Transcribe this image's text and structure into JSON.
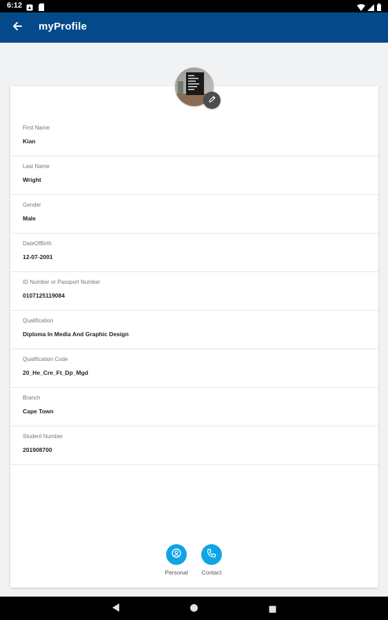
{
  "status_bar": {
    "time": "6:12",
    "left_icons": [
      "notification-icon",
      "sim-card-icon"
    ],
    "right_icons": [
      "wifi-icon",
      "signal-icon",
      "battery-icon"
    ]
  },
  "app_bar": {
    "title": "myProfile",
    "back_icon": "arrow-left-icon",
    "color": "#044a8a"
  },
  "profile": {
    "edit_icon": "pencil-icon",
    "fields": [
      {
        "label": "First Name",
        "value": "Kian"
      },
      {
        "label": "Last Name",
        "value": "Wright"
      },
      {
        "label": "Gender",
        "value": "Male"
      },
      {
        "label": "DateOfBirth",
        "value": "12-07-2001"
      },
      {
        "label": "ID Number or Passport Number",
        "value": "0107125119084"
      },
      {
        "label": "Qualification",
        "value": "Diploma In Media And Graphic Design"
      },
      {
        "label": "Qualification Code",
        "value": "20_He_Cre_Ft_Dp_Mgd"
      },
      {
        "label": "Branch",
        "value": "Cape Town"
      },
      {
        "label": "Student Number",
        "value": "201908700"
      }
    ]
  },
  "tabs": [
    {
      "label": "Personal",
      "icon": "person-icon"
    },
    {
      "label": "Contact",
      "icon": "phone-icon"
    }
  ],
  "accent_color": "#0fa4e6",
  "nav_bar": {
    "buttons": [
      "back-triangle-icon",
      "home-circle-icon",
      "recents-square-icon"
    ]
  }
}
